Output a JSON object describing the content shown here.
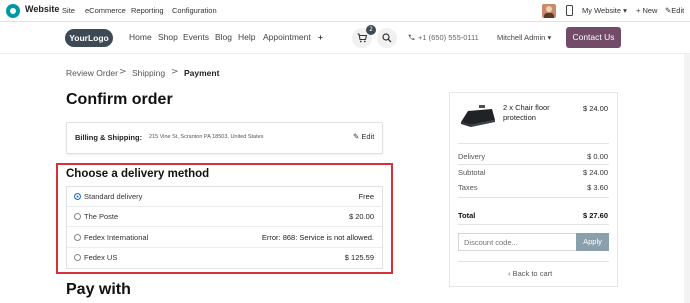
{
  "admin_bar": {
    "app_name": "Website",
    "menu": [
      "Site",
      "eCommerce",
      "Reporting",
      "Configuration"
    ],
    "website_switch": "My Website",
    "new_label": "+ New",
    "edit_label": "Edit"
  },
  "header": {
    "logo_text": "YourLogo",
    "nav": [
      "Home",
      "Shop",
      "Events",
      "Blog",
      "Help",
      "Appointment"
    ],
    "nav_more": "+",
    "cart_count": "2",
    "phone": "+1 (650) 555-0111",
    "user": "Mitchell Admin",
    "contact_label": "Contact Us",
    "accent": "#714b67"
  },
  "breadcrumb": {
    "steps": [
      "Review Order",
      "Shipping",
      "Payment"
    ],
    "separator": ">"
  },
  "page_title": "Confirm order",
  "billing": {
    "label": "Billing & Shipping:",
    "address": "215 Vine St, Scranton PA 18503, United States",
    "edit_label": "Edit"
  },
  "delivery": {
    "title": "Choose a delivery method",
    "highlight_color": "#d6303a",
    "selected": "Standard delivery",
    "methods": [
      {
        "name": "Standard delivery",
        "price": "Free"
      },
      {
        "name": "The Poste",
        "price": "$ 20.00"
      },
      {
        "name": "Fedex International",
        "price": "Error: 868: Service is not allowed."
      },
      {
        "name": "Fedex US",
        "price": "$ 125.59"
      }
    ]
  },
  "pay_title": "Pay with",
  "summary": {
    "product_name": "2 x Chair floor protection",
    "product_price": "$ 24.00",
    "rows": [
      {
        "label": "Delivery",
        "value": "$ 0.00"
      },
      {
        "label": "Subtotal",
        "value": "$ 24.00"
      },
      {
        "label": "Taxes",
        "value": "$ 3.60"
      }
    ],
    "total_label": "Total",
    "total_value": "$ 27.60",
    "discount_placeholder": "Discount code...",
    "apply_label": "Apply",
    "back_label": "Back to cart"
  }
}
